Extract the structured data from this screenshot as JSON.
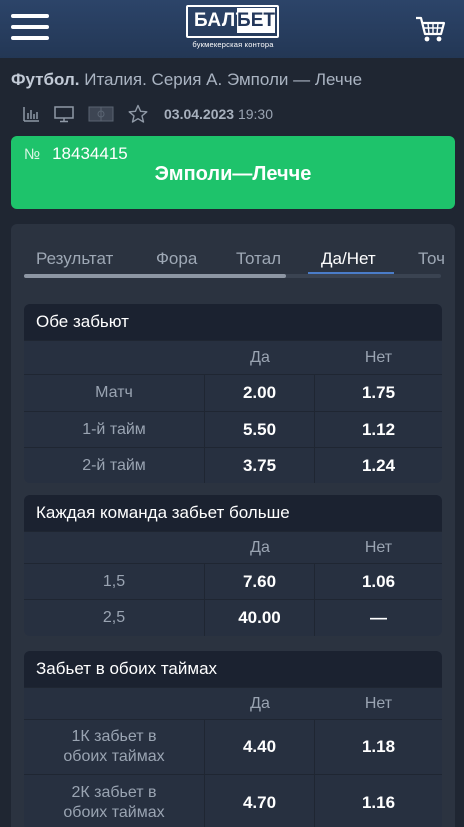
{
  "header": {
    "logo_left": "БАЛТ",
    "logo_right": "БЕТ",
    "logo_sub": "букмекерская контора"
  },
  "breadcrumb": {
    "sport": "Футбол.",
    "path": "Италия. Серия А. Эмполи — Лечче"
  },
  "meta": {
    "date": "03.04.2023",
    "time": "19:30"
  },
  "event": {
    "number_label": "№",
    "number": "18434415",
    "title": "Эмполи—Лечче"
  },
  "tabs": [
    {
      "label": "Результат"
    },
    {
      "label": "Фора"
    },
    {
      "label": "Тотал"
    },
    {
      "label": "Да/Нет"
    },
    {
      "label": "Точ"
    }
  ],
  "markets": [
    {
      "title": "Обе забьют",
      "col_yes": "Да",
      "col_no": "Нет",
      "rows": [
        {
          "name": "Матч",
          "yes": "2.00",
          "no": "1.75"
        },
        {
          "name": "1-й тайм",
          "yes": "5.50",
          "no": "1.12"
        },
        {
          "name": "2-й тайм",
          "yes": "3.75",
          "no": "1.24"
        }
      ]
    },
    {
      "title": "Каждая команда забьет больше",
      "col_yes": "Да",
      "col_no": "Нет",
      "rows": [
        {
          "name": "1,5",
          "yes": "7.60",
          "no": "1.06"
        },
        {
          "name": "2,5",
          "yes": "40.00",
          "no": "—"
        }
      ]
    },
    {
      "title": "Забьет в обоих таймах",
      "col_yes": "Да",
      "col_no": "Нет",
      "rows": [
        {
          "name_1": "1К забьет в",
          "name_2": "обоих таймах",
          "yes": "4.40",
          "no": "1.18"
        },
        {
          "name_1": "2К забьет в",
          "name_2": "обоих таймах",
          "yes": "4.70",
          "no": "1.16"
        }
      ]
    }
  ],
  "colors": {
    "accent_green": "#1ec36b",
    "header_blue": "#2c4469",
    "tab_underline": "#4a7cc8"
  },
  "icons": [
    "menu-icon",
    "cart-icon",
    "stats-icon",
    "tv-icon",
    "field-icon",
    "star-icon"
  ]
}
